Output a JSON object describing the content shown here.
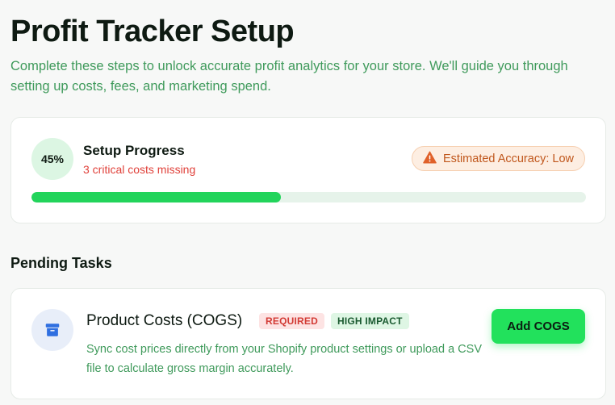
{
  "header": {
    "title": "Profit Tracker Setup",
    "subtitle": "Complete these steps to unlock accurate profit analytics for your store. We'll guide you through setting up costs, fees, and marketing spend."
  },
  "progress": {
    "percent_label": "45%",
    "percent_value": 45,
    "title": "Setup Progress",
    "missing": "3 critical costs missing",
    "accuracy_label": "Estimated Accuracy: Low",
    "accuracy_icon": "warning-triangle-icon"
  },
  "pending": {
    "section_title": "Pending Tasks",
    "tasks": [
      {
        "icon": "archive-box-icon",
        "title": "Product Costs (COGS)",
        "badges": [
          "REQUIRED",
          "HIGH IMPACT"
        ],
        "description": "Sync cost prices directly from your Shopify product settings or upload a CSV file to calculate gross margin accurately.",
        "action_label": "Add COGS"
      }
    ]
  },
  "colors": {
    "accent_green": "#22e15c",
    "progress_fill": "#22d45b",
    "warning_orange": "#c0571c",
    "error_red": "#e0413a",
    "icon_blue": "#2f6fe0"
  }
}
